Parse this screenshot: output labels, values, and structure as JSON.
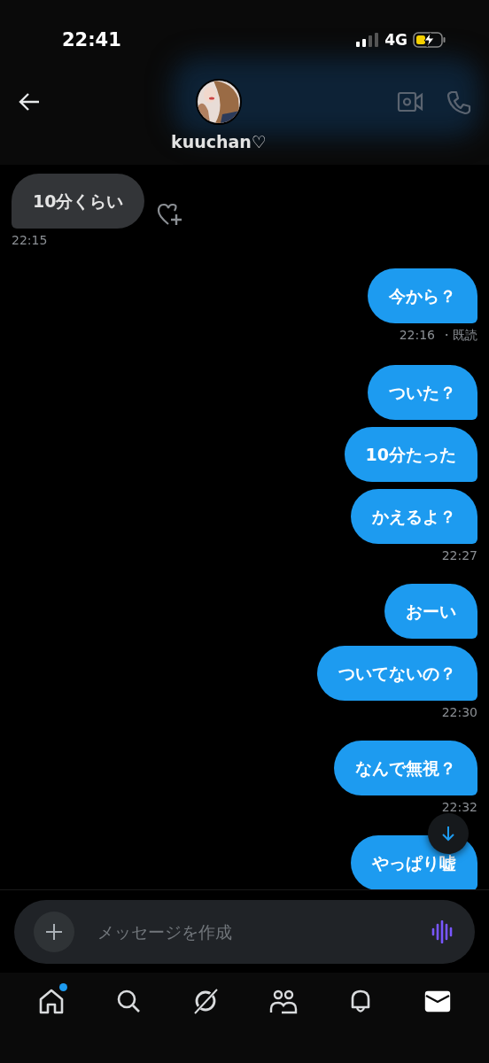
{
  "status_bar": {
    "time": "22:41",
    "network": "4G"
  },
  "header": {
    "name": "kuuchan♡"
  },
  "messages": [
    {
      "kind": "received",
      "text": "10分くらい",
      "time": "22:15"
    },
    {
      "kind": "sent",
      "text": "今から？",
      "time": "22:16",
      "receipt": "・既読"
    },
    {
      "kind": "sent",
      "text": "ついた？"
    },
    {
      "kind": "sent",
      "text": "10分たった"
    },
    {
      "kind": "sent",
      "text": "かえるよ？",
      "time": "22:27"
    },
    {
      "kind": "sent",
      "text": "おーい"
    },
    {
      "kind": "sent",
      "text": "ついてないの？",
      "time": "22:30"
    },
    {
      "kind": "sent",
      "text": "なんで無視？",
      "time": "22:32"
    },
    {
      "kind": "sent",
      "text": "やっぱり嘘"
    }
  ],
  "composer": {
    "placeholder": "メッセージを作成"
  },
  "tabs": [
    {
      "selected": false,
      "badge": true
    },
    {
      "selected": false,
      "badge": false
    },
    {
      "selected": false,
      "badge": false
    },
    {
      "selected": false,
      "badge": false
    },
    {
      "selected": false,
      "badge": false
    },
    {
      "selected": true,
      "badge": false
    }
  ]
}
